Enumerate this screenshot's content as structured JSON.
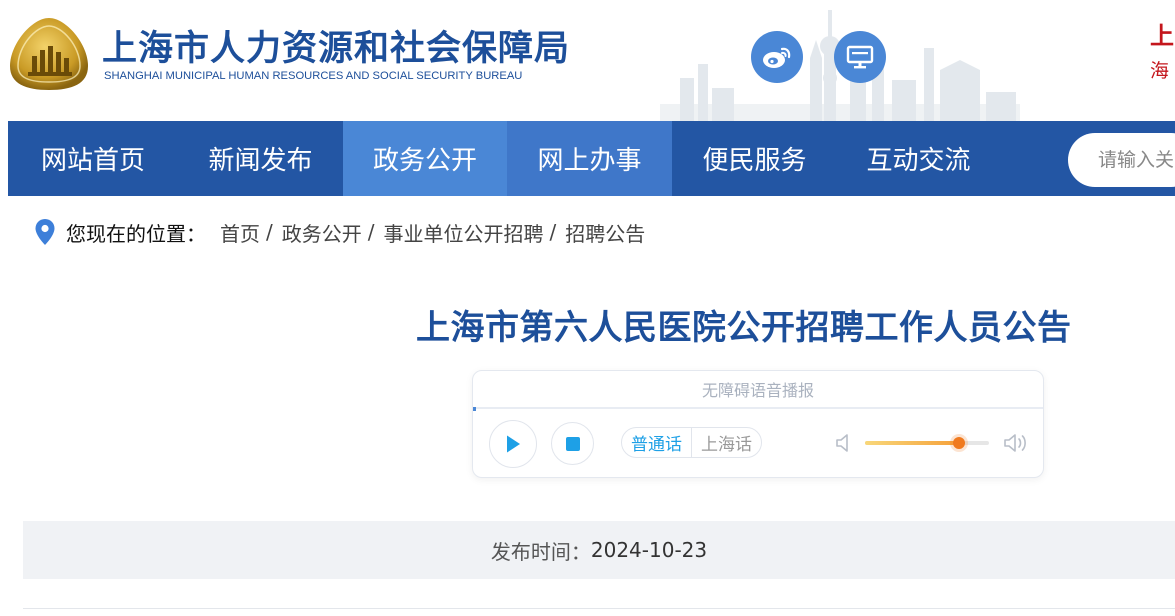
{
  "header": {
    "title": "上海市人力资源和社会保障局",
    "subtitle": "SHANGHAI MUNICIPAL HUMAN RESOURCES AND SOCIAL SECURITY BUREAU",
    "right_text_1": "上",
    "right_text_2": "海",
    "icons": {
      "logo": "bureau-emblem",
      "weibo": "weibo-icon",
      "desktop": "desktop-icon"
    }
  },
  "nav": {
    "items": [
      {
        "label": "网站首页"
      },
      {
        "label": "新闻发布"
      },
      {
        "label": "政务公开"
      },
      {
        "label": "网上办事"
      },
      {
        "label": "便民服务"
      },
      {
        "label": "互动交流"
      }
    ],
    "active_index": 2,
    "search_placeholder": "请输入关"
  },
  "breadcrumb": {
    "label": "您现在的位置：",
    "items": [
      "首页",
      "政务公开",
      "事业单位公开招聘",
      "招聘公告"
    ],
    "separator": "/"
  },
  "article": {
    "title": "上海市第六人民医院公开招聘工作人员公告",
    "player": {
      "header": "无障碍语音播报",
      "languages": [
        "普通话",
        "上海话"
      ],
      "selected_language": "普通话",
      "volume": 0.76
    },
    "publish_label": "发布时间：",
    "publish_date": "2024-10-23"
  },
  "colors": {
    "brand_blue": "#2356a4",
    "active_nav": "#4a87d6",
    "title_blue": "#1d4f9a",
    "accent_red": "#c4161c"
  }
}
